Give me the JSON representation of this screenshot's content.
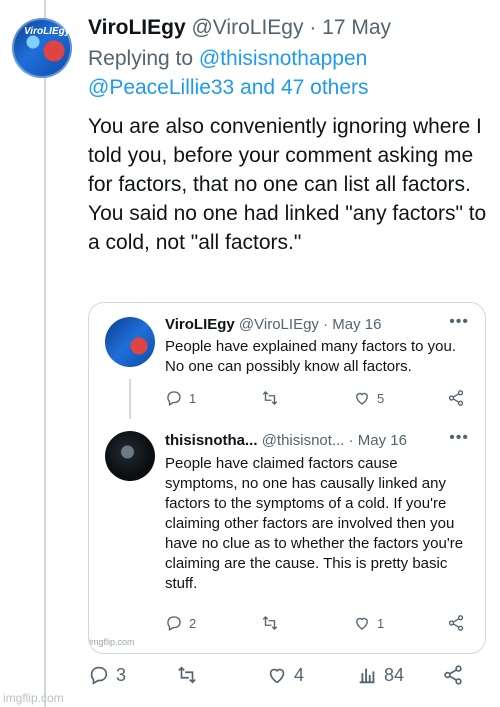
{
  "tweet": {
    "author_name": "ViroLIEgy",
    "author_handle": "@ViroLIEgy",
    "separator": "·",
    "date": "17 May",
    "avatar_text": "ViroLIEgy",
    "reply_prefix": "Replying to",
    "reply_mention_1": "@thisisnothappen",
    "reply_mention_2": "@PeaceLillie33 and 47 others",
    "text": "You are also conveniently ignoring where I told you, before your comment asking me for factors, that no one can list all factors. You said no one had linked \"any factors\" to a cold, not \"all factors.\"",
    "actions": {
      "replies": "3",
      "retweets": "",
      "likes": "4",
      "views": "84"
    }
  },
  "quoted": {
    "tweet1": {
      "author_name": "ViroLIEgy",
      "author_handle": "@ViroLIEgy",
      "separator": "·",
      "date": "May 16",
      "text": "People have explained many factors to you. No one can possibly know all factors.",
      "replies": "1",
      "likes": "5"
    },
    "tweet2": {
      "author_name": "thisisnotha...",
      "author_handle": "@thisisnot...",
      "separator": "·",
      "date": "May 16",
      "text": "People have claimed factors cause symptoms, no one has causally linked any factors to the symptoms of a cold. If you're claiming other factors are involved then you have no clue as to whether the factors you're claiming are the cause. This is pretty basic stuff.",
      "replies": "2",
      "likes": "1"
    },
    "embedded_watermark": "imgflip.com"
  },
  "watermark": "imgflip.com",
  "icons": {
    "reply": "reply-icon",
    "retweet": "retweet-icon",
    "like": "heart-icon",
    "views": "views-icon",
    "share": "share-icon",
    "more": "more-icon"
  },
  "colors": {
    "text": "#0f1419",
    "muted": "#536471",
    "link": "#1d9bf0",
    "border": "#cfd9de"
  }
}
